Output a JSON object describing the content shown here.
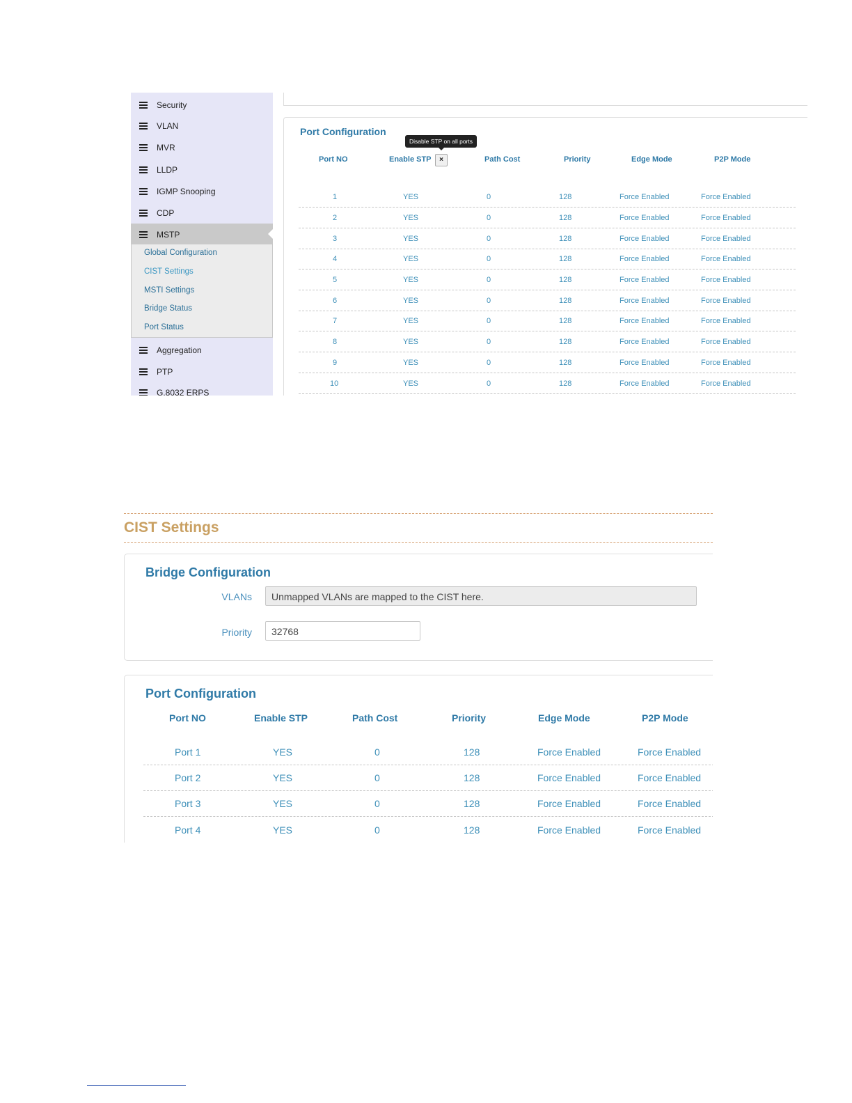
{
  "sidebar": {
    "items": [
      {
        "label": "Security",
        "icon": "menu-list-icon"
      },
      {
        "label": "VLAN",
        "icon": "menu-list-icon"
      },
      {
        "label": "MVR",
        "icon": "menu-list-icon"
      },
      {
        "label": "LLDP",
        "icon": "menu-list-icon"
      },
      {
        "label": "IGMP Snooping",
        "icon": "menu-list-icon"
      },
      {
        "label": "CDP",
        "icon": "menu-list-icon"
      },
      {
        "label": "MSTP",
        "icon": "menu-list-icon",
        "active": true
      },
      {
        "label": "Aggregation",
        "icon": "menu-list-icon"
      },
      {
        "label": "PTP",
        "icon": "menu-list-icon"
      },
      {
        "label": "G.8032 ERPS",
        "icon": "menu-list-icon"
      }
    ],
    "submenu": [
      {
        "label": "Global Configuration"
      },
      {
        "label": "CIST Settings",
        "current": true
      },
      {
        "label": "MSTI Settings"
      },
      {
        "label": "Bridge Status"
      },
      {
        "label": "Port Status"
      }
    ]
  },
  "screen1": {
    "port_config_title": "Port Configuration",
    "tooltip": "Disable STP on all ports",
    "disable_button": "×",
    "headers": [
      "Port NO",
      "Enable STP",
      "Path Cost",
      "Priority",
      "Edge Mode",
      "P2P Mode"
    ],
    "rows": [
      [
        "1",
        "YES",
        "0",
        "128",
        "Force Enabled",
        "Force Enabled"
      ],
      [
        "2",
        "YES",
        "0",
        "128",
        "Force Enabled",
        "Force Enabled"
      ],
      [
        "3",
        "YES",
        "0",
        "128",
        "Force Enabled",
        "Force Enabled"
      ],
      [
        "4",
        "YES",
        "0",
        "128",
        "Force Enabled",
        "Force Enabled"
      ],
      [
        "5",
        "YES",
        "0",
        "128",
        "Force Enabled",
        "Force Enabled"
      ],
      [
        "6",
        "YES",
        "0",
        "128",
        "Force Enabled",
        "Force Enabled"
      ],
      [
        "7",
        "YES",
        "0",
        "128",
        "Force Enabled",
        "Force Enabled"
      ],
      [
        "8",
        "YES",
        "0",
        "128",
        "Force Enabled",
        "Force Enabled"
      ],
      [
        "9",
        "YES",
        "0",
        "128",
        "Force Enabled",
        "Force Enabled"
      ],
      [
        "10",
        "YES",
        "0",
        "128",
        "Force Enabled",
        "Force Enabled"
      ]
    ]
  },
  "screen2": {
    "section_title": "CIST Settings",
    "bridge_title": "Bridge Configuration",
    "vlans_label": "VLANs",
    "vlans_value": "Unmapped VLANs are mapped to the CIST here.",
    "priority_label": "Priority",
    "priority_value": "32768",
    "port_config_title": "Port Configuration",
    "headers": [
      "Port NO",
      "Enable STP",
      "Path Cost",
      "Priority",
      "Edge Mode",
      "P2P Mode"
    ],
    "rows": [
      [
        "Port 1",
        "YES",
        "0",
        "128",
        "Force Enabled",
        "Force Enabled"
      ],
      [
        "Port 2",
        "YES",
        "0",
        "128",
        "Force Enabled",
        "Force Enabled"
      ],
      [
        "Port 3",
        "YES",
        "0",
        "128",
        "Force Enabled",
        "Force Enabled"
      ],
      [
        "Port 4",
        "YES",
        "0",
        "128",
        "Force Enabled",
        "Force Enabled"
      ]
    ]
  },
  "colors": {
    "accent": "#2f7aa7",
    "link": "#3d8fb8",
    "section_title": "#c9a062",
    "sidebar_bg": "#e6e6f7"
  }
}
